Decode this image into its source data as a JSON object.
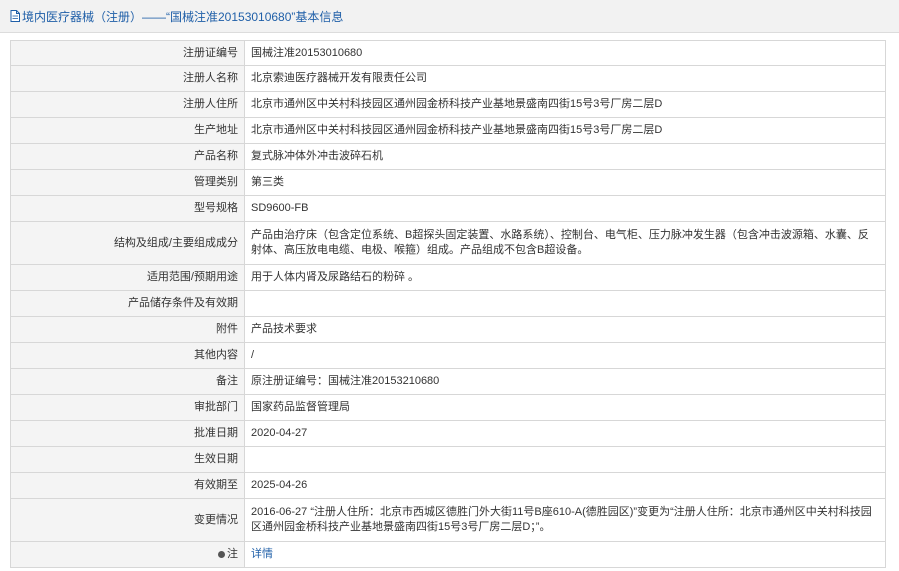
{
  "header": {
    "icon": "document-icon",
    "title": "境内医疗器械（注册）——“国械注准20153010680”基本信息",
    "accent": "#1f5fa8"
  },
  "rows": [
    {
      "label": "注册证编号",
      "value": "国械注准20153010680"
    },
    {
      "label": "注册人名称",
      "value": "北京索迪医疗器械开发有限责任公司"
    },
    {
      "label": "注册人住所",
      "value": "北京市通州区中关村科技园区通州园金桥科技产业基地景盛南四街15号3号厂房二层D"
    },
    {
      "label": "生产地址",
      "value": "北京市通州区中关村科技园区通州园金桥科技产业基地景盛南四街15号3号厂房二层D"
    },
    {
      "label": "产品名称",
      "value": "复式脉冲体外冲击波碎石机"
    },
    {
      "label": "管理类别",
      "value": "第三类"
    },
    {
      "label": "型号规格",
      "value": "SD9600-FB"
    },
    {
      "label": "结构及组成/主要组成成分",
      "value": "产品由治疗床（包含定位系统、B超探头固定装置、水路系统）、控制台、电气柜、压力脉冲发生器（包含冲击波源箱、水囊、反射体、高压放电电缆、电极、喉箍）组成。产品组成不包含B超设备。"
    },
    {
      "label": "适用范围/预期用途",
      "value": "用于人体内肾及尿路结石的粉碎 。"
    },
    {
      "label": "产品储存条件及有效期",
      "value": ""
    },
    {
      "label": "附件",
      "value": "产品技术要求"
    },
    {
      "label": "其他内容",
      "value": "/"
    },
    {
      "label": "备注",
      "value": "原注册证编号：国械注准20153210680"
    },
    {
      "label": "审批部门",
      "value": "国家药品监督管理局"
    },
    {
      "label": "批准日期",
      "value": "2020-04-27"
    },
    {
      "label": "生效日期",
      "value": ""
    },
    {
      "label": "有效期至",
      "value": "2025-04-26"
    },
    {
      "label": "变更情况",
      "value": "2016-06-27 “注册人住所：北京市西城区德胜门外大街11号B座610-A(德胜园区)”变更为“注册人住所：北京市通州区中关村科技园区通州园金桥科技产业基地景盛南四街15号3号厂房二层D；”。"
    }
  ],
  "note": {
    "label": "注",
    "icon": "bullet-icon",
    "link_text": "详情"
  }
}
